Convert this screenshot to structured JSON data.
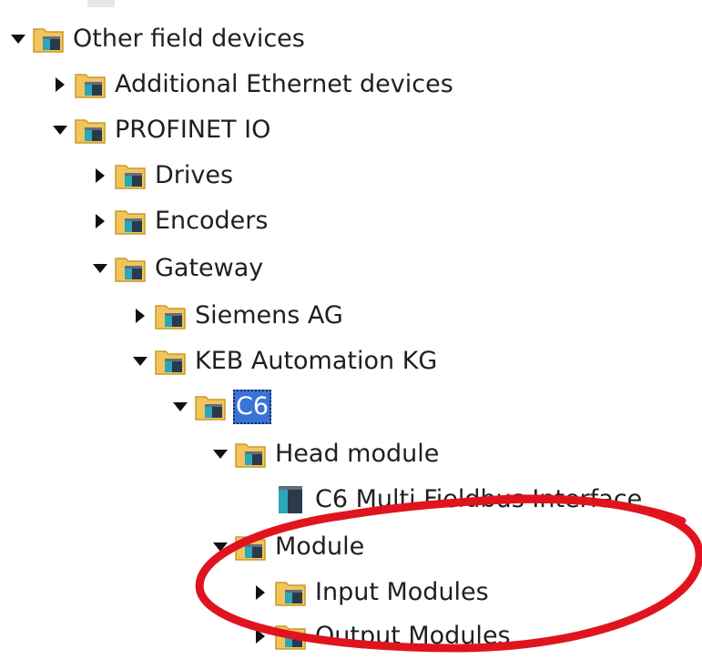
{
  "tree": {
    "items": [
      {
        "label": "Other field devices",
        "expander": "expanded",
        "icon": "folder-icon"
      },
      {
        "label": "Additional Ethernet devices",
        "expander": "collapsed",
        "icon": "folder-icon"
      },
      {
        "label": "PROFINET IO",
        "expander": "expanded",
        "icon": "folder-icon"
      },
      {
        "label": "Drives",
        "expander": "collapsed",
        "icon": "folder-icon"
      },
      {
        "label": "Encoders",
        "expander": "collapsed",
        "icon": "folder-icon"
      },
      {
        "label": "Gateway",
        "expander": "expanded",
        "icon": "folder-icon"
      },
      {
        "label": "Siemens AG",
        "expander": "collapsed",
        "icon": "folder-icon"
      },
      {
        "label": "KEB Automation KG",
        "expander": "expanded",
        "icon": "folder-icon"
      },
      {
        "label": "C6",
        "expander": "expanded",
        "icon": "folder-icon",
        "selected": true
      },
      {
        "label": "Head module",
        "expander": "expanded",
        "icon": "folder-icon"
      },
      {
        "label": "C6 Multi Fieldbus Interface",
        "expander": "none",
        "icon": "device-module-icon"
      },
      {
        "label": "Module",
        "expander": "expanded",
        "icon": "folder-icon"
      },
      {
        "label": "Input Modules",
        "expander": "collapsed",
        "icon": "folder-icon"
      },
      {
        "label": "Output Modules",
        "expander": "collapsed",
        "icon": "folder-icon"
      }
    ]
  },
  "colors": {
    "selection": "#3a73d6",
    "folder": "#f2c55c",
    "folder_edge": "#c89a2a",
    "device_teal": "#2aa7b8",
    "device_dark": "#2b3a4a",
    "annotation": "#e0141e"
  }
}
